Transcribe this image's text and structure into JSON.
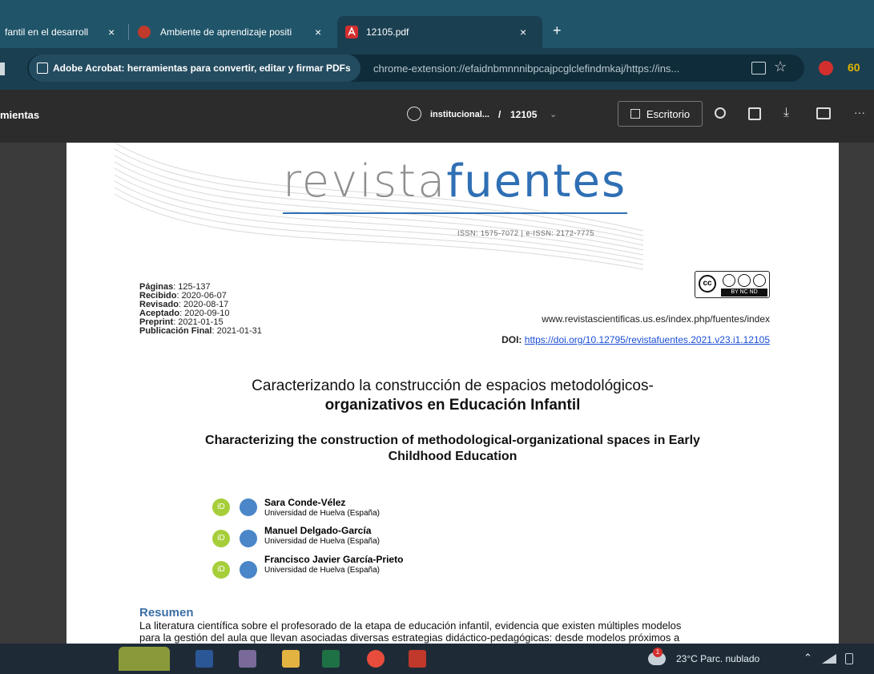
{
  "browser": {
    "tabs": [
      {
        "label": "fantil en el desarroll"
      },
      {
        "label": "Ambiente de aprendizaje positi"
      },
      {
        "label": "12105.pdf"
      }
    ],
    "close_glyph": "×",
    "new_tab_glyph": "+",
    "extension_label": "Adobe Acrobat: herramientas para convertir, editar y firmar PDFs",
    "url": "chrome-extension://efaidnbmnnnibpcajpcglclefindmkaj/https://ins...",
    "profile_badge": "60"
  },
  "pdf_toolbar": {
    "tools_label": "mientas",
    "breadcrumb": "institucional...",
    "separator": "/",
    "file_id": "12105",
    "desktop_button": "Escritorio",
    "more_glyph": "···"
  },
  "document": {
    "logo_left": "revista",
    "logo_right": "fuentes",
    "issn": "ISSN: 1575-7072 | e-ISSN: 2172-7775",
    "license_badge_text": "BY  NC  ND",
    "meta": [
      {
        "key": "Páginas",
        "value": ": 125-137"
      },
      {
        "key": "Recibido",
        "value": ": 2020-06-07"
      },
      {
        "key": "Revisado",
        "value": ": 2020-08-17"
      },
      {
        "key": "Aceptado",
        "value": ": 2020-09-10"
      },
      {
        "key": "Preprint",
        "value": ": 2021-01-15"
      },
      {
        "key": "Publicación Final",
        "value": ": 2021-01-31"
      }
    ],
    "journal_url": "www.revistascientificas.us.es/index.php/fuentes/index",
    "doi_label": "DOI:",
    "doi_link": "https://doi.org/10.12795/revistafuentes.2021.v23.i1.12105",
    "title_es_line1": "Caracterizando la construcción de espacios metodológicos-",
    "title_es_line2": "organizativos en Educación Infantil",
    "title_en_line1": "Characterizing the construction of methodological-organizational spaces in Early",
    "title_en_line2": "Childhood Education",
    "authors": [
      {
        "name": "Sara Conde-Vélez",
        "affiliation": "Universidad de Huelva (España)"
      },
      {
        "name": "Manuel Delgado-García",
        "affiliation": "Universidad de Huelva (España)"
      },
      {
        "name": "Francisco Javier García-Prieto",
        "affiliation": "Universidad de Huelva (España)"
      }
    ],
    "orcid_glyph": "iD",
    "abstract_heading": "Resumen",
    "abstract_line1": "La literatura científica sobre el profesorado de la etapa de educación infantil, evidencia que existen múltiples modelos",
    "abstract_line2": "para la gestión del aula que llevan asociadas diversas estrategias didáctico-pedagógicas: desde modelos próximos a"
  },
  "taskbar": {
    "weather": "23°C  Parc. nublado",
    "weather_badge": "1"
  },
  "colors": {
    "tab_strip": "#1f5469",
    "active_tab": "#1a3f51",
    "pdf_toolbar": "#2c2c2c",
    "logo_gray": "#8e8e8e",
    "logo_blue": "#2f6fb4",
    "orcid_green": "#a6ce39",
    "mail_blue": "#4a86c8",
    "abstract_heading": "#3a6fa6",
    "acrobat_red": "#d32f2f"
  }
}
